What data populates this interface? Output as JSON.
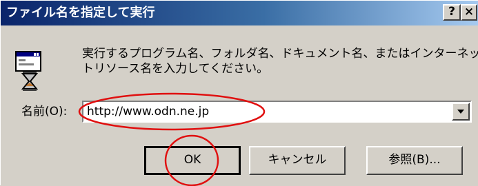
{
  "window": {
    "title": "ファイル名を指定して実行",
    "help_label": "?",
    "close_label": "×"
  },
  "icon": "run-program-icon",
  "message": {
    "line1": "実行するプログラム名、フォルダ名、ドキュメント名、またはインターネッ",
    "line2": "トリソース名を入力してください。"
  },
  "name_field": {
    "label": "名前(O):",
    "value": "http://www.odn.ne.jp"
  },
  "buttons": {
    "ok": "OK",
    "cancel": "キャンセル",
    "browse": "参照(B)..."
  },
  "colors": {
    "dialog_bg": "#d4d0c8",
    "title_start": "#0a246a",
    "title_end": "#a6caf0",
    "annotation": "#e01010"
  }
}
